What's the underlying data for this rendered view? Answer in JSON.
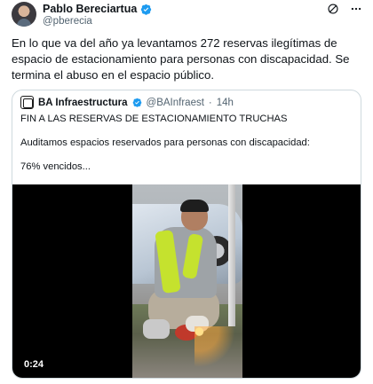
{
  "tweet": {
    "author_name": "Pablo Bereciartua",
    "handle": "@pberecia",
    "text": "En lo que va del año ya levantamos 272 reservas ilegítimas de espacio de estacionamiento para personas con discapacidad. Se termina el abuso en el espacio público."
  },
  "quote": {
    "author_name": "BA Infraestructura",
    "handle": "@BAInfraest",
    "separator": "·",
    "time": "14h",
    "line1": "FIN A LAS RESERVAS DE ESTACIONAMIENTO TRUCHAS",
    "line2": "Auditamos espacios reservados para personas con discapacidad:",
    "line3": "76% vencidos..."
  },
  "video": {
    "duration": "0:24"
  },
  "icons": {
    "verified": "verified-badge-icon",
    "grok": "grok-icon",
    "more": "more-options-icon"
  },
  "colors": {
    "verified_blue": "#1d9bf0",
    "text": "#0f1419",
    "muted": "#536471",
    "border": "#cfd9de"
  }
}
